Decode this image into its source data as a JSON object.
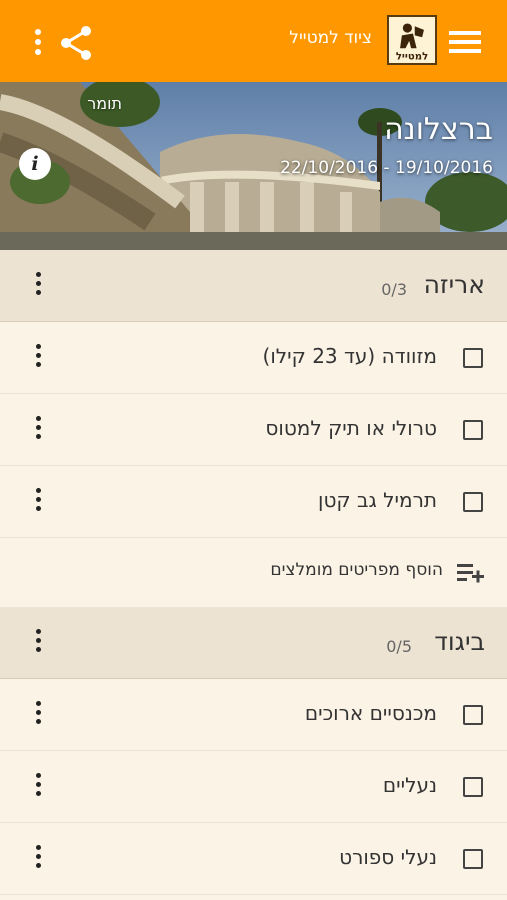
{
  "toolbar": {
    "title": "ציוד למטייל",
    "logo_text": "למטייל",
    "menu_icon": "more-vert-icon",
    "share_icon": "share-icon",
    "nav_icon": "hamburger-icon",
    "color": "#ff9800"
  },
  "trip": {
    "owner": "תומר",
    "title": "ברצלונה",
    "dates": "22/10/2016 - 19/10/2016",
    "info_label": "i"
  },
  "sections": [
    {
      "title": "אריזה",
      "count": "0/3",
      "items": [
        {
          "label": "מזוודה (עד 23 קילו)",
          "checked": false
        },
        {
          "label": "טרולי או תיק למטוס",
          "checked": false
        },
        {
          "label": "תרמיל גב קטן",
          "checked": false
        }
      ],
      "add_label": "הוסף מפריטים מומלצים"
    },
    {
      "title": "ביגוד",
      "count": "0/5",
      "items": [
        {
          "label": "מכנסיים ארוכים",
          "checked": false
        },
        {
          "label": "נעליים",
          "checked": false
        },
        {
          "label": "נעלי ספורט",
          "checked": false
        }
      ]
    }
  ],
  "colors": {
    "background": "#fbf3e6",
    "section_bg": "#ede3d2",
    "accent": "#ff9800"
  }
}
